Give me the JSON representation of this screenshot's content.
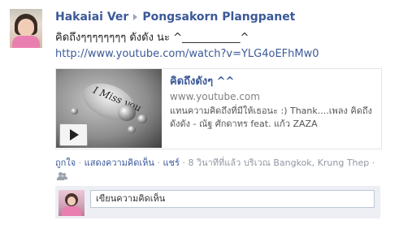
{
  "post": {
    "author": "Hakaiai Ver",
    "recipient": "Pongsakorn Plangpanet",
    "message": "คิดถึงๆๆๆๆๆๆๆๆ ดังดัง นะ ^___________^",
    "link_url": "http://www.youtube.com/watch?v=YLG4oEFhMw0"
  },
  "attachment": {
    "thumbnail_text": "I Miss you",
    "title": "คิดถึงดังๆ ^^",
    "domain": "www.youtube.com",
    "description": "แทนความคิดถึงที่มีให้เธอนะ :) Thank....เพลง คิดถึงดังดัง - ณัฐ ศักดาทร feat. แก้ว ZAZA"
  },
  "actions": {
    "like": "ถูกใจ",
    "comment": "แสดงความคิดเห็น",
    "share": "แชร์",
    "separator": "·",
    "timestamp": "8 วินาทีที่แล้ว",
    "location": "บริเวณ Bangkok, Krung Thep",
    "audience_icon": "friends-icon"
  },
  "comment_box": {
    "placeholder": "เขียนความคิดเห็น"
  },
  "colors": {
    "link": "#3b5998",
    "meta_text": "#9197a3",
    "comment_bg": "#edeff4"
  }
}
